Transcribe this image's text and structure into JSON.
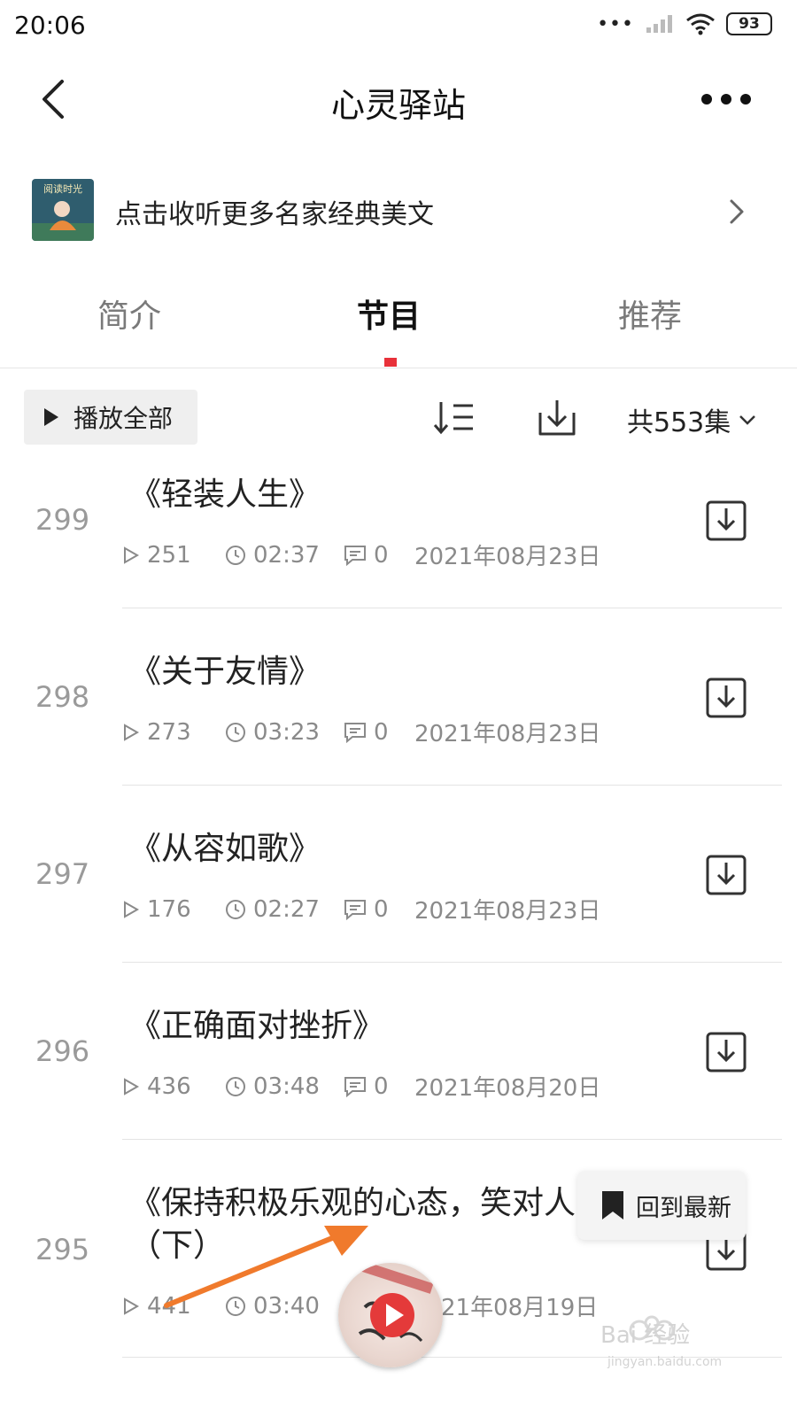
{
  "status_bar": {
    "time": "20:06",
    "battery": "93"
  },
  "header": {
    "title": "心灵驿站"
  },
  "banner": {
    "text": "点击收听更多名家经典美文",
    "image_text": "阅读时光"
  },
  "tabs": [
    {
      "label": "简介",
      "active": false
    },
    {
      "label": "节目",
      "active": true
    },
    {
      "label": "推荐",
      "active": false
    }
  ],
  "toolbar": {
    "play_all_label": "播放全部",
    "count_label": "共553集"
  },
  "episodes": [
    {
      "number": "299",
      "title": "《轻装人生》",
      "plays": "251",
      "duration": "02:37",
      "comments": "0",
      "date": "2021年08月23日"
    },
    {
      "number": "298",
      "title": "《关于友情》",
      "plays": "273",
      "duration": "03:23",
      "comments": "0",
      "date": "2021年08月23日"
    },
    {
      "number": "297",
      "title": "《从容如歌》",
      "plays": "176",
      "duration": "02:27",
      "comments": "0",
      "date": "2021年08月23日"
    },
    {
      "number": "296",
      "title": "《正确面对挫折》",
      "plays": "436",
      "duration": "03:48",
      "comments": "0",
      "date": "2021年08月20日"
    },
    {
      "number": "295",
      "title": "《保持积极乐观的心态，笑对人",
      "title_line2": "（下）",
      "plays": "441",
      "duration": "03:40",
      "comments": "",
      "date": "21年08月19日"
    }
  ],
  "floating": {
    "back_to_latest_label": "回到最新"
  },
  "watermark": {
    "text": "Bai 经验",
    "url": "jingyan.baidu.com"
  },
  "colors": {
    "accent": "#e8313a",
    "annotation_arrow": "#f07a2c"
  }
}
